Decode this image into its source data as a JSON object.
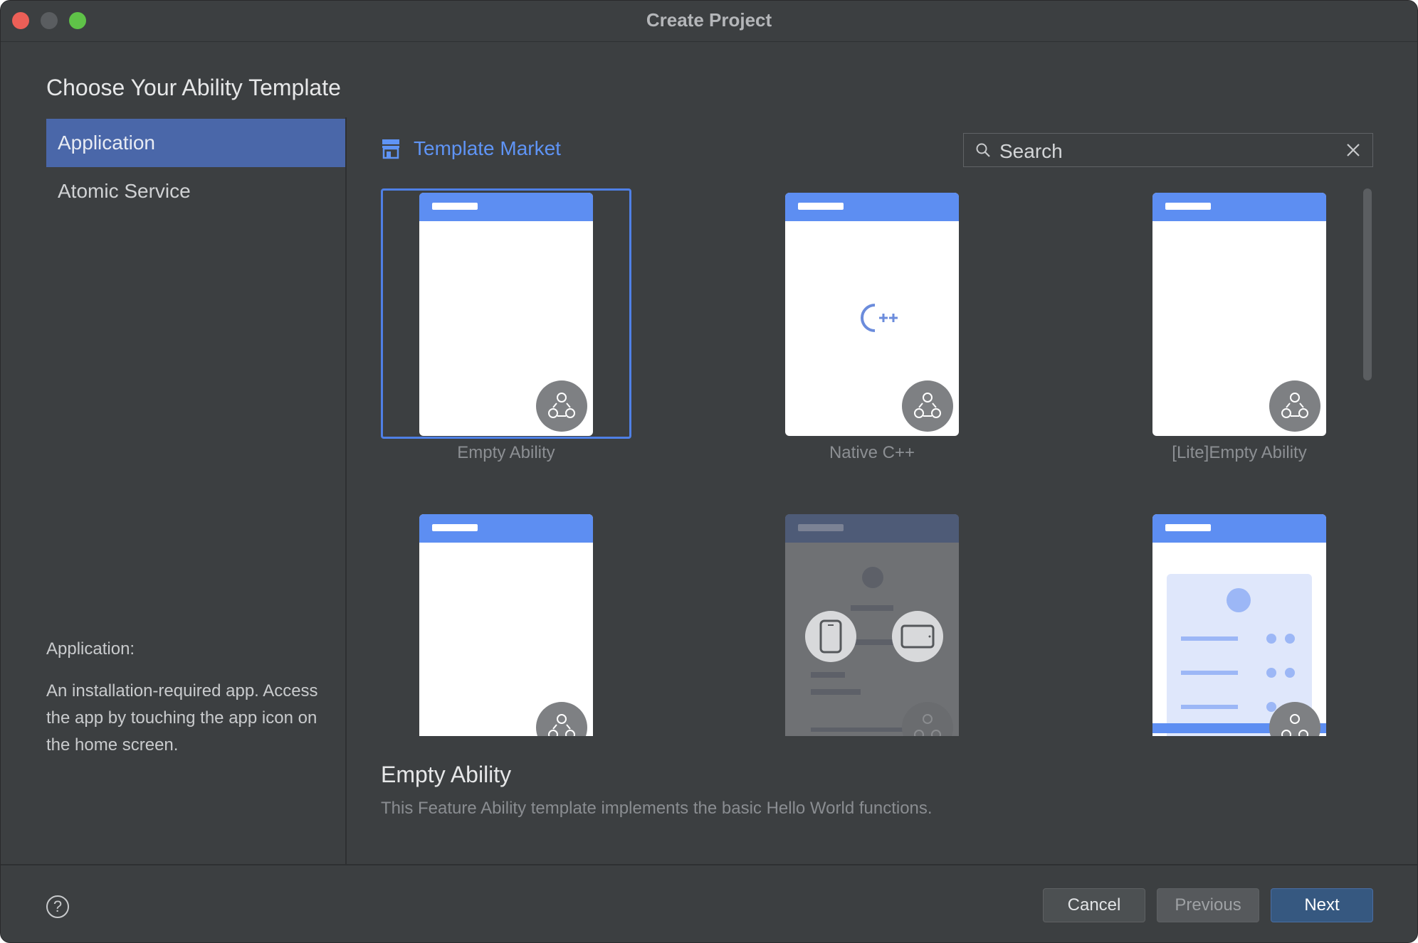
{
  "window": {
    "title": "Create Project"
  },
  "heading": "Choose Your Ability Template",
  "sidebar": {
    "items": [
      {
        "label": "Application",
        "active": true
      },
      {
        "label": "Atomic Service",
        "active": false
      }
    ],
    "description_title": "Application:",
    "description": "An installation-required app. Access the app by touching the app icon on the home screen."
  },
  "market": {
    "label": "Template Market",
    "icon": "store-icon"
  },
  "search": {
    "value": "Search",
    "icon": "search-icon",
    "clear_icon": "close-icon"
  },
  "templates": [
    {
      "label": "Empty Ability",
      "selected": true
    },
    {
      "label": "Native C++",
      "selected": false,
      "logo_text": "C++"
    },
    {
      "label": "[Lite]Empty Ability",
      "selected": false
    },
    {
      "label": "",
      "selected": false
    },
    {
      "label": "",
      "selected": false
    },
    {
      "label": "",
      "selected": false
    }
  ],
  "selected_template": {
    "name": "Empty Ability",
    "description": "This Feature Ability template implements the basic Hello World functions."
  },
  "footer": {
    "help": "?",
    "cancel": "Cancel",
    "previous": "Previous",
    "next": "Next"
  },
  "colors": {
    "accent": "#5d8ef2",
    "sidebar_active": "#4a67a9",
    "background": "#3c3f41"
  }
}
